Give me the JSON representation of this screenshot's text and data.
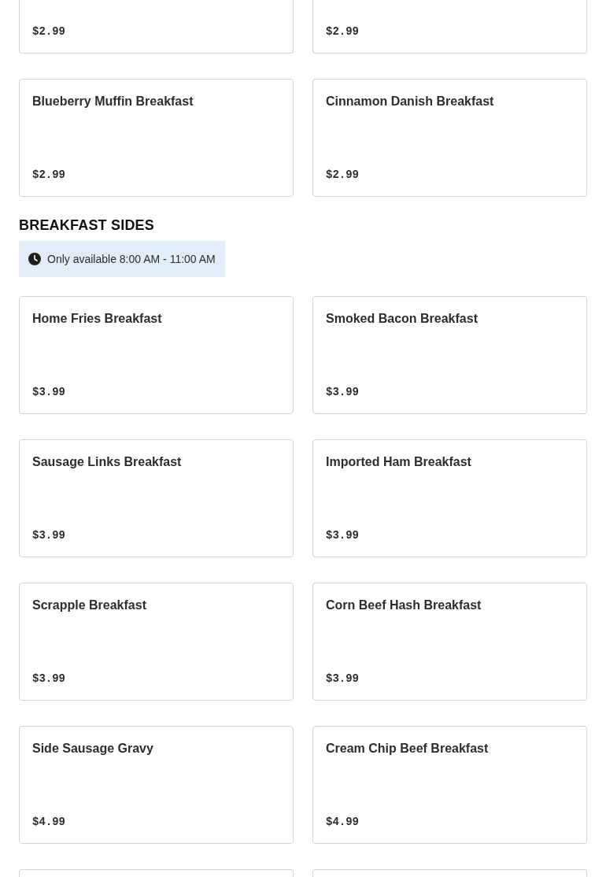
{
  "sections": [
    {
      "items": [
        {
          "kind": "cut_top",
          "price": "$2.99"
        },
        {
          "kind": "cut_top",
          "price": "$2.99"
        },
        {
          "kind": "full",
          "name": "Blueberry Muffin Breakfast",
          "price": "$2.99"
        },
        {
          "kind": "full",
          "name": "Cinnamon Danish Breakfast",
          "price": "$2.99"
        }
      ]
    },
    {
      "title": "BREAKFAST SIDES",
      "availability": "Only available 8:00 AM - 11:00 AM",
      "items": [
        {
          "kind": "full",
          "name": "Home Fries Breakfast",
          "price": "$3.99"
        },
        {
          "kind": "full",
          "name": "Smoked Bacon Breakfast",
          "price": "$3.99"
        },
        {
          "kind": "full",
          "name": "Sausage Links Breakfast",
          "price": "$3.99"
        },
        {
          "kind": "full",
          "name": "Imported Ham Breakfast",
          "price": "$3.99"
        },
        {
          "kind": "full",
          "name": "Scrapple Breakfast",
          "price": "$3.99"
        },
        {
          "kind": "full",
          "name": "Corn Beef Hash Breakfast",
          "price": "$3.99"
        },
        {
          "kind": "full",
          "name": "Side Sausage Gravy",
          "price": "$4.99"
        },
        {
          "kind": "full",
          "name": "Cream Chip Beef Breakfast",
          "price": "$4.99"
        },
        {
          "kind": "cut_bottom"
        },
        {
          "kind": "cut_bottom"
        }
      ]
    }
  ]
}
